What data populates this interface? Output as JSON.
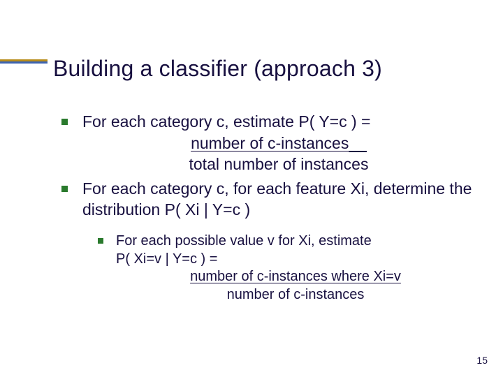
{
  "title": "Building a classifier (approach 3)",
  "bullets": {
    "b1": "For each category c, estimate P( Y=c ) =",
    "frac1_num": "number of c-instances",
    "frac1_num_trail": "    ",
    "frac1_den": "total number of instances",
    "b2": "For each category c, for each feature Xi, determine the distribution P( Xi | Y=c )",
    "sub1_line1": "For each possible value v for Xi, estimate",
    "sub1_line2": "P( Xi=v | Y=c ) =",
    "frac2_num": "number of c-instances where Xi=v",
    "frac2_den": "number of c-instances"
  },
  "page_number": "15"
}
